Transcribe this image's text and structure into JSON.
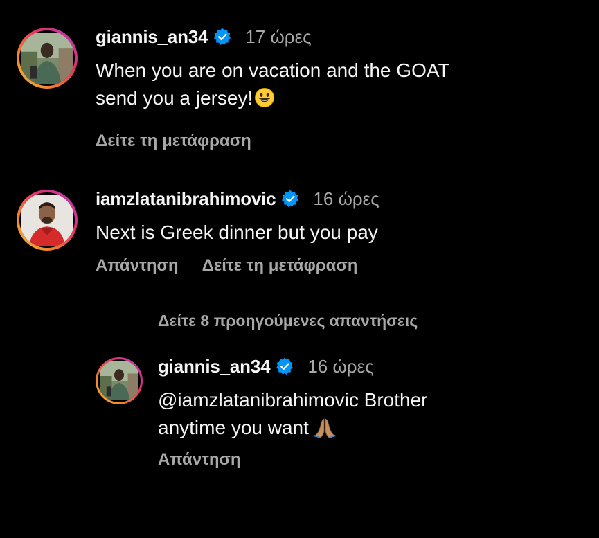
{
  "comments": [
    {
      "username": "giannis_an34",
      "time": "17 ώρες",
      "text": "When you are on vacation and the GOAT",
      "text2": "send you a jersey!",
      "emoji": "grinning-face-emoji",
      "translate": "Δείτε τη μετάφραση"
    },
    {
      "username": "iamzlatanibrahimovic",
      "time": "16 ώρες",
      "text": "Next is Greek dinner but you pay",
      "reply": "Απάντηση",
      "translate": "Δείτε τη μετάφραση"
    }
  ],
  "view_replies": "Δείτε 8 προηγούμενες απαντήσεις",
  "reply": {
    "username": "giannis_an34",
    "time": "16 ώρες",
    "mention": "@iamzlatanibrahimovic",
    "text": " Brother",
    "text2": "anytime you want",
    "emoji": "folded-hands-emoji",
    "reply_label": "Απάντηση"
  },
  "colors": {
    "background": "#000000",
    "text": "#f5f5f5",
    "secondary": "#a8a8a8",
    "verified": "#0095f6",
    "story_ring": "#e1306c"
  }
}
